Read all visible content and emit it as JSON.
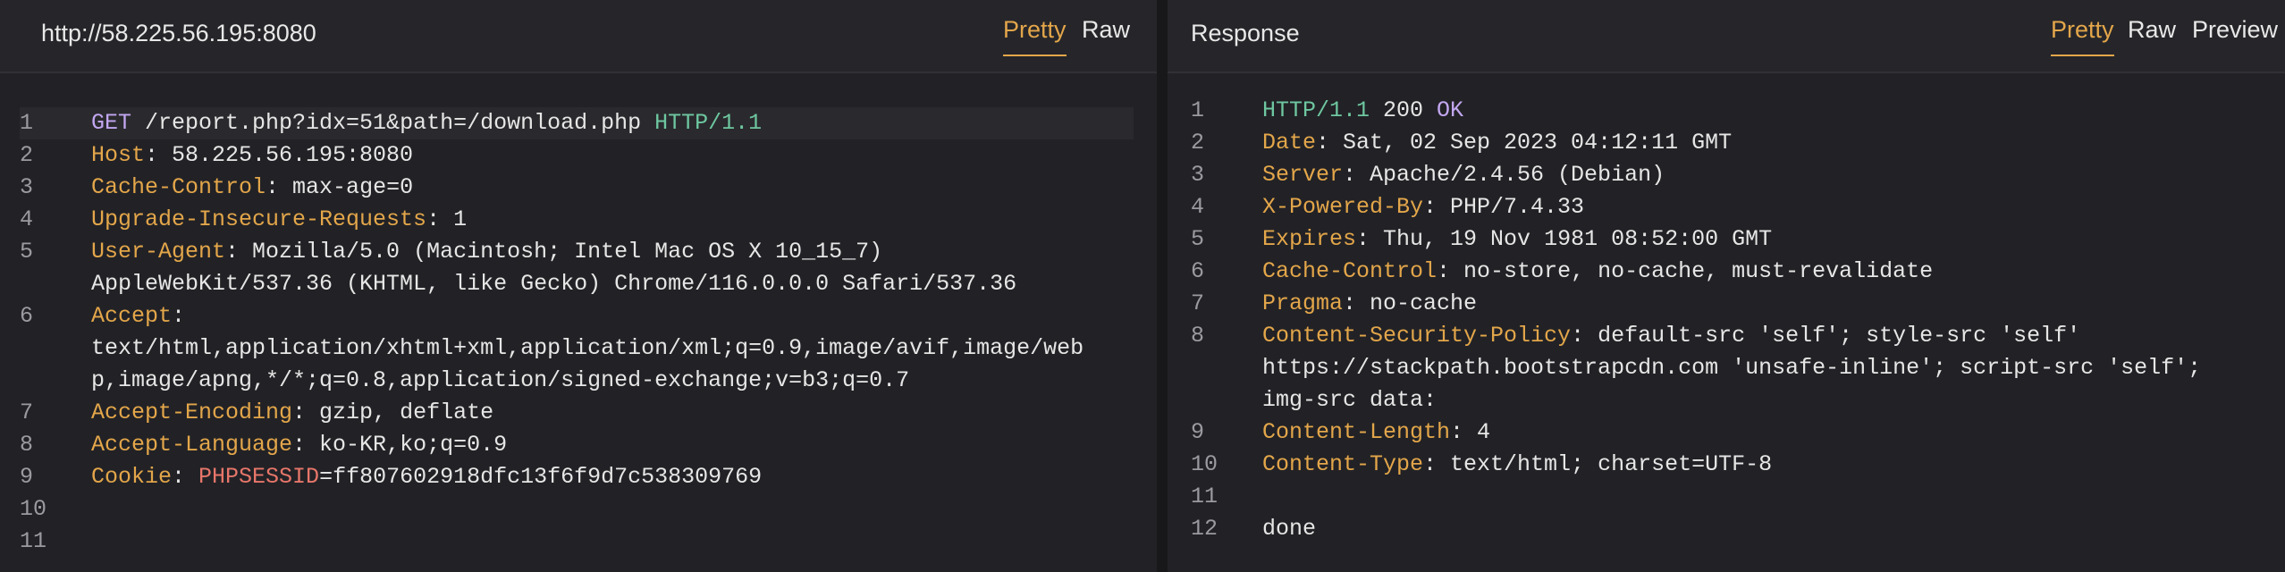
{
  "request": {
    "title": "http://58.225.56.195:8080",
    "tabs": [
      "Pretty",
      "Raw"
    ],
    "lines": [
      {
        "num": "1",
        "parts": [
          {
            "t": "GET",
            "c": "method"
          },
          {
            "t": " /report.php?idx=51&path=/download.php ",
            "c": "text"
          },
          {
            "t": "HTTP/1.1",
            "c": "proto"
          }
        ]
      },
      {
        "num": "2",
        "parts": [
          {
            "t": "Host",
            "c": "key"
          },
          {
            "t": ": 58.225.56.195:8080",
            "c": "text"
          }
        ]
      },
      {
        "num": "3",
        "parts": [
          {
            "t": "Cache-Control",
            "c": "key"
          },
          {
            "t": ": max-age=0",
            "c": "text"
          }
        ]
      },
      {
        "num": "4",
        "parts": [
          {
            "t": "Upgrade-Insecure-Requests",
            "c": "key"
          },
          {
            "t": ": 1",
            "c": "text"
          }
        ]
      },
      {
        "num": "5",
        "parts": [
          {
            "t": "User-Agent",
            "c": "key"
          },
          {
            "t": ": Mozilla/5.0 (Macintosh; Intel Mac OS X 10_15_7)\nAppleWebKit/537.36 (KHTML, like Gecko) Chrome/116.0.0.0 Safari/537.36",
            "c": "text"
          }
        ]
      },
      {
        "num": "6",
        "parts": [
          {
            "t": "Accept",
            "c": "key"
          },
          {
            "t": ":\ntext/html,application/xhtml+xml,application/xml;q=0.9,image/avif,image/web\np,image/apng,*/*;q=0.8,application/signed-exchange;v=b3;q=0.7",
            "c": "text"
          }
        ]
      },
      {
        "num": "7",
        "parts": [
          {
            "t": "Accept-Encoding",
            "c": "key"
          },
          {
            "t": ": gzip, deflate",
            "c": "text"
          }
        ]
      },
      {
        "num": "8",
        "parts": [
          {
            "t": "Accept-Language",
            "c": "key"
          },
          {
            "t": ": ko-KR,ko;q=0.9",
            "c": "text"
          }
        ]
      },
      {
        "num": "9",
        "parts": [
          {
            "t": "Cookie",
            "c": "key"
          },
          {
            "t": ": ",
            "c": "text"
          },
          {
            "t": "PHPSESSID",
            "c": "cookie"
          },
          {
            "t": "=ff807602918dfc13f6f9d7c538309769",
            "c": "text"
          }
        ]
      },
      {
        "num": "10",
        "parts": []
      },
      {
        "num": "11",
        "parts": []
      }
    ]
  },
  "response": {
    "title": "Response",
    "tabs": [
      "Pretty",
      "Raw",
      "Preview"
    ],
    "lines": [
      {
        "num": "1",
        "parts": [
          {
            "t": "HTTP/1.1",
            "c": "proto"
          },
          {
            "t": " 200 ",
            "c": "text"
          },
          {
            "t": "OK",
            "c": "status"
          }
        ]
      },
      {
        "num": "2",
        "parts": [
          {
            "t": "Date",
            "c": "key"
          },
          {
            "t": ": Sat, 02 Sep 2023 04:12:11 GMT",
            "c": "text"
          }
        ]
      },
      {
        "num": "3",
        "parts": [
          {
            "t": "Server",
            "c": "key"
          },
          {
            "t": ": Apache/2.4.56 (Debian)",
            "c": "text"
          }
        ]
      },
      {
        "num": "4",
        "parts": [
          {
            "t": "X-Powered-By",
            "c": "key"
          },
          {
            "t": ": PHP/7.4.33",
            "c": "text"
          }
        ]
      },
      {
        "num": "5",
        "parts": [
          {
            "t": "Expires",
            "c": "key"
          },
          {
            "t": ": Thu, 19 Nov 1981 08:52:00 GMT",
            "c": "text"
          }
        ]
      },
      {
        "num": "6",
        "parts": [
          {
            "t": "Cache-Control",
            "c": "key"
          },
          {
            "t": ": no-store, no-cache, must-revalidate",
            "c": "text"
          }
        ]
      },
      {
        "num": "7",
        "parts": [
          {
            "t": "Pragma",
            "c": "key"
          },
          {
            "t": ": no-cache",
            "c": "text"
          }
        ]
      },
      {
        "num": "8",
        "parts": [
          {
            "t": "Content-Security-Policy",
            "c": "key"
          },
          {
            "t": ": default-src 'self'; style-src 'self'\nhttps://stackpath.bootstrapcdn.com 'unsafe-inline'; script-src 'self';\nimg-src data:",
            "c": "text"
          }
        ]
      },
      {
        "num": "9",
        "parts": [
          {
            "t": "Content-Length",
            "c": "key"
          },
          {
            "t": ": 4",
            "c": "text"
          }
        ]
      },
      {
        "num": "10",
        "parts": [
          {
            "t": "Content-Type",
            "c": "key"
          },
          {
            "t": ": text/html; charset=UTF-8",
            "c": "text"
          }
        ]
      },
      {
        "num": "11",
        "parts": []
      },
      {
        "num": "12",
        "parts": [
          {
            "t": "done",
            "c": "text"
          }
        ]
      }
    ]
  },
  "colors": {
    "accent": "#e3a64a",
    "method": "#c2a6f0",
    "protocol": "#6ec7a0",
    "cookie": "#e8766a"
  }
}
